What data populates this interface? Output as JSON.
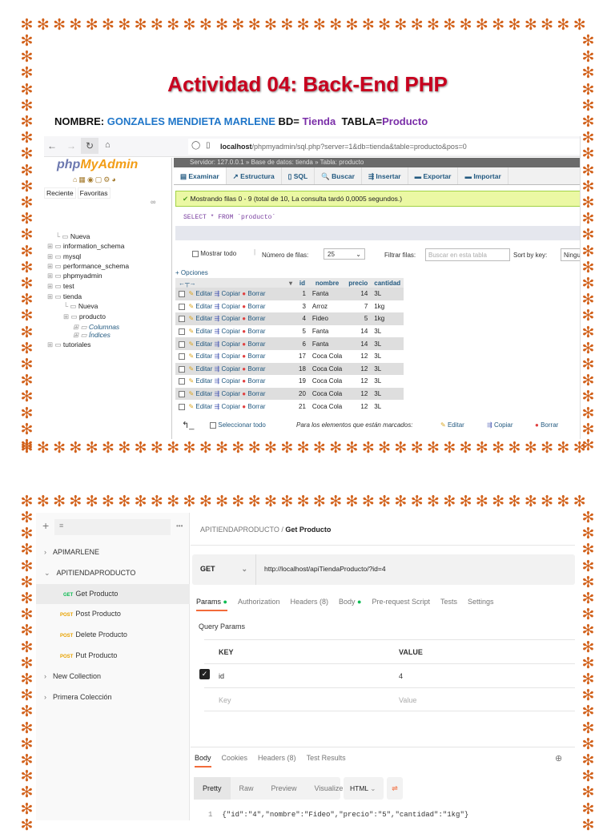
{
  "document": {
    "title": "Actividad 04: Back-End PHP",
    "name_label": "NOMBRE:",
    "name_value": "GONZALES MENDIETA MARLENE",
    "bd_label": "BD=",
    "bd_value": "Tienda",
    "tabla_label": "TABLA=",
    "tabla_value": "Producto",
    "border_glyph": "✻",
    "accent": "#d2621c",
    "title_color": "#c8001e"
  },
  "phpmyadmin": {
    "url_host": "localhost",
    "url_path": "/phpmyadmin/sql.php?server=1&db=tienda&table=producto&pos=0",
    "logo_php": "php",
    "logo_rest": "MyAdmin",
    "sidebar_tabs": [
      "Reciente",
      "Favoritas"
    ],
    "tree": [
      "Nueva",
      "information_schema",
      "mysql",
      "performance_schema",
      "phpmyadmin",
      "test",
      "tienda",
      "Nueva",
      "producto",
      "Columnas",
      "Índices",
      "tutoriales"
    ],
    "server_bar": "Servidor: 127.0.0.1 » Base de datos: tienda » Tabla: producto",
    "tabs": [
      "Examinar",
      "Estructura",
      "SQL",
      "Buscar",
      "Insertar",
      "Exportar",
      "Importar"
    ],
    "success": "Mostrando filas 0 - 9 (total de 10, La consulta tardó 0,0005 segundos.)",
    "sql": "SELECT * FROM `producto`",
    "show_all": "Mostrar todo",
    "rows_label": "Número de filas:",
    "rows_value": "25",
    "filter_label": "Filtrar filas:",
    "filter_placeholder": "Buscar en esta tabla",
    "sort_label": "Sort by key:",
    "sort_value": "Ninguna",
    "options": "+ Opciones",
    "columns": [
      "id",
      "nombre",
      "precio",
      "cantidad"
    ],
    "actions": [
      "Editar",
      "Copiar",
      "Borrar"
    ],
    "rows": [
      [
        "1",
        "Fanta",
        "14",
        "3L"
      ],
      [
        "3",
        "Arroz",
        "7",
        "1kg"
      ],
      [
        "4",
        "Fideo",
        "5",
        "1kg"
      ],
      [
        "5",
        "Fanta",
        "14",
        "3L"
      ],
      [
        "6",
        "Fanta",
        "14",
        "3L"
      ],
      [
        "17",
        "Coca Cola",
        "12",
        "3L"
      ],
      [
        "18",
        "Coca Cola",
        "12",
        "3L"
      ],
      [
        "19",
        "Coca Cola",
        "12",
        "3L"
      ],
      [
        "20",
        "Coca Cola",
        "12",
        "3L"
      ],
      [
        "21",
        "Coca Cola",
        "12",
        "3L"
      ]
    ],
    "select_all": "Seleccionar todo",
    "marked_label": "Para los elementos que están marcados:"
  },
  "postman": {
    "collections": [
      {
        "label": "APIMARLENE",
        "chev": "›"
      },
      {
        "label": "APITIENDAPRODUCTO",
        "chev": "⌄"
      }
    ],
    "requests": [
      {
        "method": "GET",
        "label": "Get Producto"
      },
      {
        "method": "POST",
        "label": "Post Producto"
      },
      {
        "method": "POST",
        "label": "Delete Producto"
      },
      {
        "method": "POST",
        "label": "Put Producto"
      }
    ],
    "more_collections": [
      "New Collection",
      "Primera Colección"
    ],
    "breadcrumb_parent": "APITIENDAPRODUCTO",
    "breadcrumb_current": "Get Producto",
    "method": "GET",
    "url": "http://localhost/apiTiendaProducto/?id=4",
    "req_tabs": [
      "Params",
      "Authorization",
      "Headers (8)",
      "Body",
      "Pre-request Script",
      "Tests",
      "Settings"
    ],
    "query_params": "Query Params",
    "key_header": "KEY",
    "value_header": "VALUE",
    "param_key": "id",
    "param_value": "4",
    "key_placeholder": "Key",
    "value_placeholder": "Value",
    "resp_tabs": [
      "Body",
      "Cookies",
      "Headers (8)",
      "Test Results"
    ],
    "view_modes": [
      "Pretty",
      "Raw",
      "Preview",
      "Visualize"
    ],
    "format": "HTML",
    "line_no": "1",
    "response": "{\"id\":\"4\",\"nombre\":\"Fideo\",\"precio\":\"5\",\"cantidad\":\"1kg\"}"
  }
}
